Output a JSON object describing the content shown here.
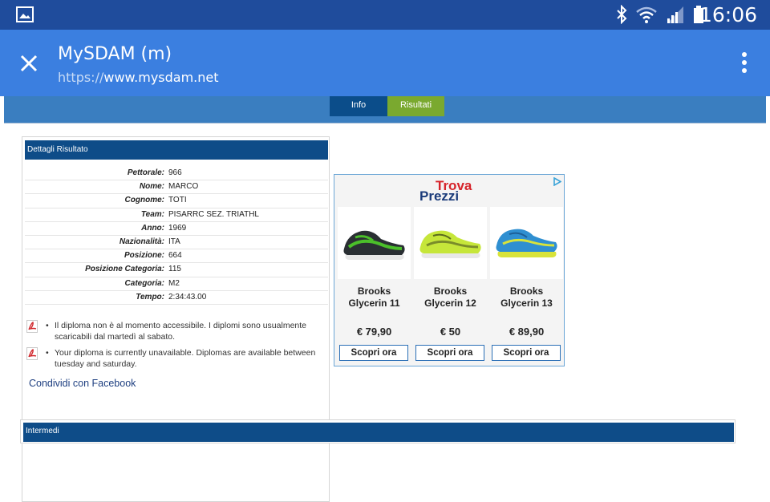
{
  "status_bar": {
    "time": "16:06",
    "left_icon": "gallery-icon",
    "right_icons": [
      "bluetooth-icon",
      "wifi-icon",
      "signal-icon",
      "battery-icon"
    ]
  },
  "toolbar": {
    "title": "MySDAM (m)",
    "url_scheme": "https://",
    "url_host": "www.mysdam.net",
    "close_icon": "close-icon",
    "menu_icon": "more-vert-icon"
  },
  "tabs": [
    {
      "label": "Info"
    },
    {
      "label": "Risultati"
    }
  ],
  "details": {
    "header": "Dettagli Risultato",
    "rows": [
      {
        "label": "Pettorale:",
        "value": "966"
      },
      {
        "label": "Nome:",
        "value": "MARCO"
      },
      {
        "label": "Cognome:",
        "value": "TOTI"
      },
      {
        "label": "Team:",
        "value": "PISARRC SEZ. TRIATHL"
      },
      {
        "label": "Anno:",
        "value": "1969"
      },
      {
        "label": "Nazionalità:",
        "value": "ITA"
      },
      {
        "label": "Posizione:",
        "value": "664"
      },
      {
        "label": "Posizione Categoria:",
        "value": "115"
      },
      {
        "label": "Categoria:",
        "value": "M2"
      },
      {
        "label": "Tempo:",
        "value": "2:34:43.00"
      }
    ],
    "notes": [
      {
        "icon": "pdf-icon",
        "text": "Il diploma non è al momento accessibile. I diplomi sono usualmente scaricabili dal martedì al sabato."
      },
      {
        "icon": "pdf-icon",
        "text": "Your diploma is currently unavailable. Diplomas are available between tuesday and saturday."
      }
    ],
    "share_link": "Condividi con Facebook"
  },
  "ad": {
    "logo_line1": "Trova",
    "logo_line2": "Prezzi",
    "products": [
      {
        "name": "Brooks Glycerin 11",
        "price": "€ 79,90",
        "button": "Scopri ora",
        "colors": {
          "upper": "#2a2f33",
          "accent": "#4bbf2a",
          "sole": "#e8e8e8"
        }
      },
      {
        "name": "Brooks Glycerin 12",
        "price": "€ 50",
        "button": "Scopri ora",
        "colors": {
          "upper": "#c6e63a",
          "accent": "#7a8c2a",
          "sole": "#e8e8e8"
        }
      },
      {
        "name": "Brooks Glycerin 13",
        "price": "€ 89,90",
        "button": "Scopri ora",
        "colors": {
          "upper": "#2f8fd1",
          "accent": "#d8e33a",
          "sole": "#d8e33a"
        }
      }
    ]
  },
  "intermedi": {
    "header": "Intermedi"
  },
  "colors": {
    "status_bar": "#1f4c9c",
    "toolbar": "#3b7fe0",
    "tab_info": "#0b4d8a",
    "tab_risultati": "#7aa92f",
    "header_blue": "#0e4c88"
  }
}
